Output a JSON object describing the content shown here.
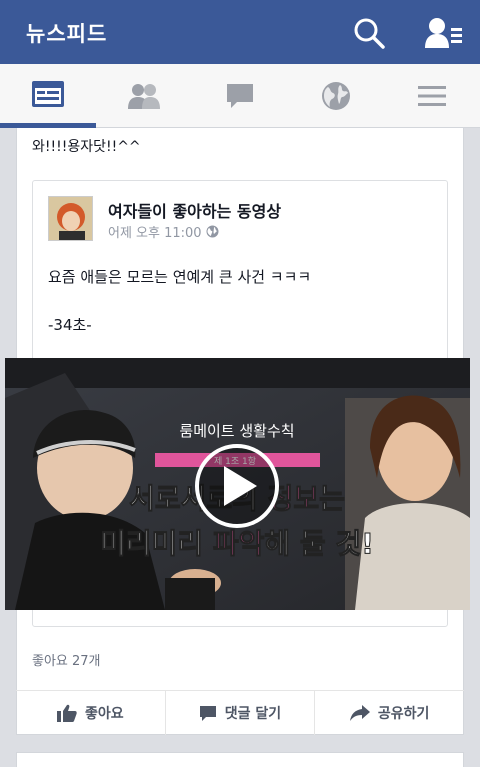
{
  "header": {
    "title": "뉴스피드"
  },
  "tabs": [
    {
      "name": "news-feed",
      "icon": "news-feed-icon",
      "active": true
    },
    {
      "name": "friend-requests",
      "icon": "friends-icon",
      "active": false
    },
    {
      "name": "messages",
      "icon": "chat-bubble-icon",
      "active": false
    },
    {
      "name": "notifications",
      "icon": "globe-icon",
      "active": false
    },
    {
      "name": "more",
      "icon": "menu-icon",
      "active": false
    }
  ],
  "post": {
    "caption": "와!!!!용자닷!!^^",
    "shared": {
      "author": "여자들이 좋아하는 동영상",
      "time": "어제 오후 11:00",
      "body_line1": "요즘 애들은 모르는 연예계 큰 사건 ㅋㅋㅋ",
      "body_line2": "-34초-"
    },
    "video": {
      "top_title": "룸메이트 생활수칙",
      "subtitle": "제 1조 1항",
      "line1_a": "서로서로의 ",
      "line1_b": "정보",
      "line1_c": "는",
      "line2_a": "미리미리 ",
      "line2_b": "파악",
      "line2_c": "해 둘 것!"
    },
    "likes": "좋아요 27개"
  },
  "actions": {
    "like": "좋아요",
    "comment": "댓글 달기",
    "share": "공유하기"
  },
  "colors": {
    "brand": "#3b5998",
    "pink": "#e0559b"
  }
}
